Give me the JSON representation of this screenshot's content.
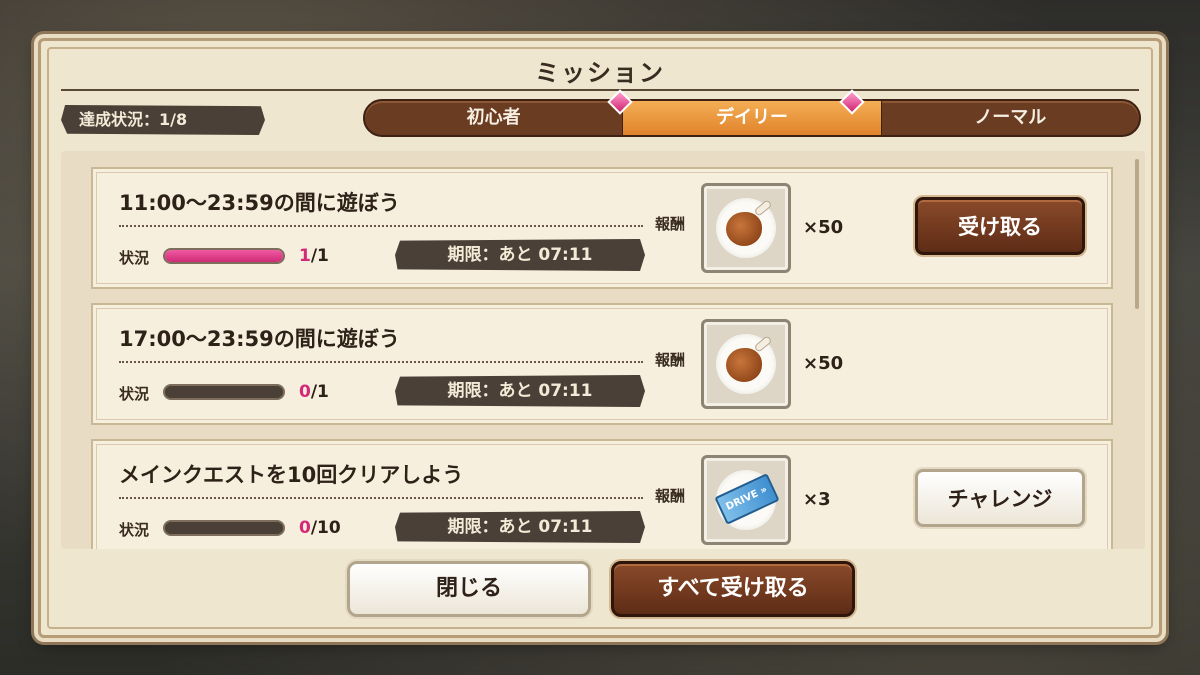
{
  "dialog": {
    "title": "ミッション",
    "achievement": "達成状況：1/8"
  },
  "tabs": [
    {
      "label": "初心者",
      "active": false
    },
    {
      "label": "デイリー",
      "active": true
    },
    {
      "label": "ノーマル",
      "active": false
    }
  ],
  "missions": [
    {
      "title": "11:00〜23:59の間に遊ぼう",
      "status_label": "状況",
      "progress_current": "1",
      "progress_total": "/1",
      "progress_fraction": 1.0,
      "deadline": "期限：あと 07:11",
      "reward_label": "報酬",
      "reward_icon": "meat-icon",
      "reward_qty": "×50",
      "button_label": "受け取る",
      "button_style": "dark"
    },
    {
      "title": "17:00〜23:59の間に遊ぼう",
      "status_label": "状況",
      "progress_current": "0",
      "progress_total": "/1",
      "progress_fraction": 0.0,
      "deadline": "期限：あと 07:11",
      "reward_label": "報酬",
      "reward_icon": "meat-icon",
      "reward_qty": "×50",
      "button_label": "",
      "button_style": "none"
    },
    {
      "title": "メインクエストを10回クリアしよう",
      "status_label": "状況",
      "progress_current": "0",
      "progress_total": "/10",
      "progress_fraction": 0.0,
      "deadline": "期限：あと 07:11",
      "reward_label": "報酬",
      "reward_icon": "ticket-icon",
      "reward_qty": "×3",
      "button_label": "チャレンジ",
      "button_style": "light"
    }
  ],
  "footer": {
    "close_label": "閉じる",
    "receive_all_label": "すべて受け取る"
  },
  "colors": {
    "accent_orange": "#e0832c",
    "progress_pink": "#d22a78",
    "dark_brown": "#5e2c16"
  }
}
